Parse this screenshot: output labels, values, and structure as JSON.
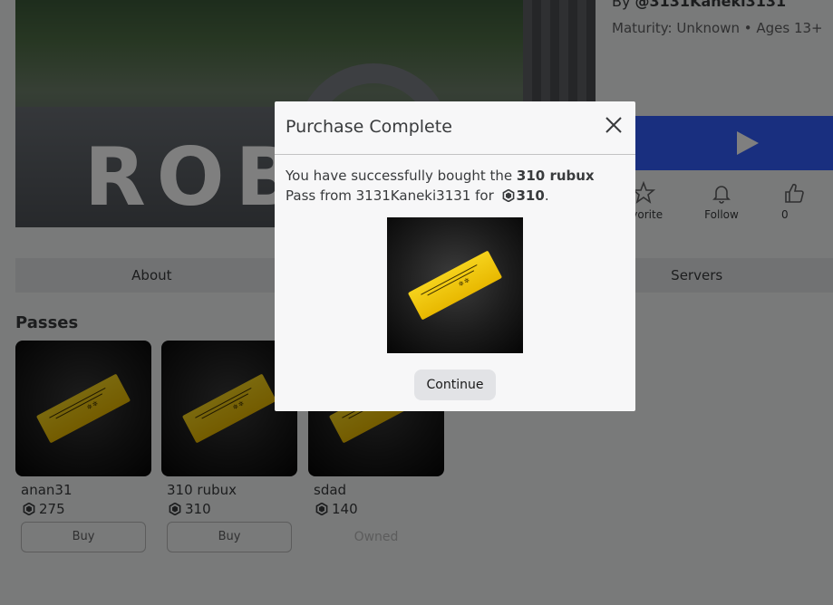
{
  "game": {
    "creator_prefix": "By ",
    "creator": "@3131Kaneki3131",
    "maturity": "Maturity: Unknown • Ages 13+",
    "logo_text": "ROB"
  },
  "actions": {
    "favorite_label": "avorite",
    "follow_label": "Follow",
    "like_count": "0"
  },
  "tabs": [
    "About",
    "",
    "Servers"
  ],
  "passes": {
    "title": "Passes",
    "items": [
      {
        "name": "anan31",
        "price": "275",
        "button": "Buy"
      },
      {
        "name": "310 rubux",
        "price": "310",
        "button": "Buy"
      },
      {
        "name": "sdad",
        "price": "140",
        "button": "Owned"
      }
    ]
  },
  "modal": {
    "title": "Purchase Complete",
    "text_before": "You have successfully bought the ",
    "pass_name": "310 rubux",
    "text_middle": " Pass from 3131Kaneki3131 for ",
    "price": "310",
    "text_after": ".",
    "continue_label": "Continue"
  },
  "colors": {
    "play_button": "#335fff",
    "ticket_gold": "#f0c808",
    "overlay": "rgba(0,0,0,0.5)"
  },
  "icons": {
    "close": "close-icon",
    "robux": "robux-icon",
    "play": "play-icon",
    "favorite": "star-icon",
    "follow": "bell-icon",
    "like": "thumbs-up-icon"
  }
}
